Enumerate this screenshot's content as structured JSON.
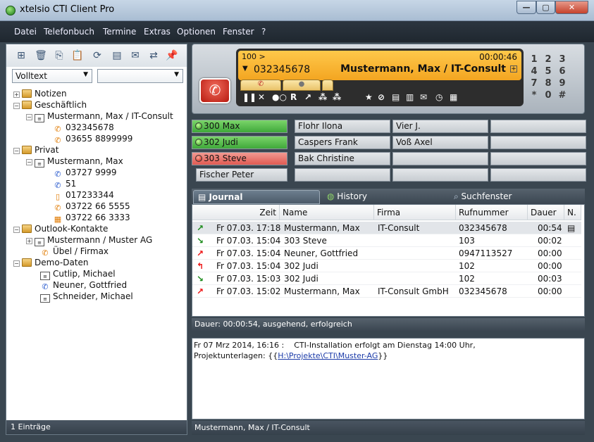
{
  "window": {
    "title": "xtelsio CTI Client Pro",
    "minimize": "—",
    "maximize": "▢",
    "close": "✕"
  },
  "menu": [
    {
      "label": "Datei"
    },
    {
      "label": "Telefonbuch"
    },
    {
      "label": "Termine"
    },
    {
      "label": "Extras"
    },
    {
      "label": "Optionen"
    },
    {
      "label": "Fenster"
    },
    {
      "label": "?"
    }
  ],
  "left": {
    "search_mode": "Volltext",
    "search_value": "",
    "status": "1 Einträge",
    "tree": [
      {
        "label": "Notizen",
        "type": "folder"
      },
      {
        "label": "Geschäftlich",
        "type": "folder"
      },
      {
        "label": "Mustermann, Max  /  IT-Consult",
        "type": "card"
      },
      {
        "label": "032345678",
        "type": "phone-orange"
      },
      {
        "label": "03655 8899999",
        "type": "phone-orange"
      },
      {
        "label": "Privat",
        "type": "folder"
      },
      {
        "label": "Mustermann, Max",
        "type": "card"
      },
      {
        "label": "03727 9999",
        "type": "phone-blue"
      },
      {
        "label": "51",
        "type": "phone-blue"
      },
      {
        "label": "017233344",
        "type": "phone-orange"
      },
      {
        "label": "03722 66 5555",
        "type": "phone-orange"
      },
      {
        "label": "03722 66 3333",
        "type": "phone-orange"
      },
      {
        "label": "Outlook-Kontakte",
        "type": "folder"
      },
      {
        "label": "Mustermann  /  Muster AG",
        "type": "card"
      },
      {
        "label": "Übel  /  Firmax",
        "type": "phone-orange"
      },
      {
        "label": "Demo-Daten",
        "type": "folder"
      },
      {
        "label": "Cutlip, Michael",
        "type": "card"
      },
      {
        "label": "Neuner, Gottfried",
        "type": "phone-blue"
      },
      {
        "label": "Schneider, Michael",
        "type": "card"
      }
    ]
  },
  "phone": {
    "line": "100 >",
    "timer": "00:00:46",
    "number": "032345678",
    "name": "Mustermann, Max  /  IT-Consult",
    "keypad": [
      "1",
      "2",
      "3",
      "4",
      "5",
      "6",
      "7",
      "8",
      "9",
      "*",
      "0",
      "#"
    ]
  },
  "blf": [
    [
      "300 Max",
      "Flohr Ilona",
      "Vier J.",
      ""
    ],
    [
      "302 Judi",
      "Caspers Frank",
      "Voß Axel",
      ""
    ],
    [
      "303 Steve",
      "Bak Christine",
      "",
      ""
    ],
    [
      "Fischer Peter",
      "",
      "",
      ""
    ]
  ],
  "tabs": {
    "journal": "Journal",
    "history": "History",
    "search": "Suchfenster"
  },
  "journal": {
    "columns": {
      "zeit": "Zeit",
      "name": "Name",
      "firma": "Firma",
      "rufnummer": "Rufnummer",
      "dauer": "Dauer",
      "n": "N."
    },
    "rows": [
      {
        "dir": "out-green",
        "zeit": "Fr 07.03. 17:18",
        "name": "Mustermann, Max",
        "firma": "IT-Consult",
        "rufnummer": "032345678",
        "dauer": "00:54",
        "note": "▤"
      },
      {
        "dir": "in",
        "zeit": "Fr 07.03. 15:04",
        "name": "303 Steve",
        "firma": "",
        "rufnummer": "103",
        "dauer": "00:02",
        "note": ""
      },
      {
        "dir": "out",
        "zeit": "Fr 07.03. 15:04",
        "name": "Neuner, Gottfried",
        "firma": "",
        "rufnummer": "0947113527",
        "dauer": "00:00",
        "note": ""
      },
      {
        "dir": "out-return",
        "zeit": "Fr 07.03. 15:04",
        "name": "302 Judi",
        "firma": "",
        "rufnummer": "102",
        "dauer": "00:00",
        "note": ""
      },
      {
        "dir": "in",
        "zeit": "Fr 07.03. 15:03",
        "name": "302 Judi",
        "firma": "",
        "rufnummer": "102",
        "dauer": "00:03",
        "note": ""
      },
      {
        "dir": "out",
        "zeit": "Fr 07.03. 15:02",
        "name": "Mustermann, Max",
        "firma": "IT-Consult GmbH",
        "rufnummer": "032345678",
        "dauer": "00:00",
        "note": ""
      }
    ],
    "status": "Dauer: 00:00:54, ausgehend, erfolgreich"
  },
  "notes": {
    "line1": "Fr 07 Mrz 2014, 16:16 :    CTI-Installation erfolgt am Dienstag 14:00 Uhr,",
    "line2_prefix": "Projektunterlagen: {{",
    "link": "H:\\Projekte\\CTI\\Muster-AG",
    "line2_suffix": "}}"
  },
  "bottom_status": "Mustermann, Max  /  IT-Consult"
}
